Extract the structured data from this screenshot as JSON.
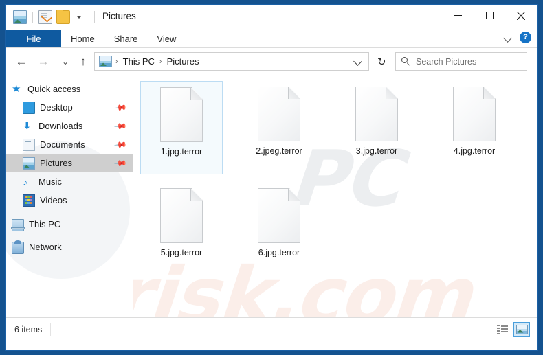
{
  "window": {
    "title": "Pictures",
    "minimize_label": "─",
    "maximize_label": "□",
    "close_label": "✕"
  },
  "quick_access_toolbar": {
    "items": [
      {
        "name": "pictures-properties-icon"
      },
      {
        "name": "properties-icon"
      },
      {
        "name": "new-folder-icon"
      },
      {
        "name": "customize-caret-icon"
      }
    ]
  },
  "ribbon": {
    "tabs": [
      {
        "label": "File",
        "active": true
      },
      {
        "label": "Home",
        "active": false
      },
      {
        "label": "Share",
        "active": false
      },
      {
        "label": "View",
        "active": false
      }
    ],
    "collapse_icon": "chevron-down-icon",
    "help_label": "?"
  },
  "addressbar": {
    "back_glyph": "←",
    "forward_glyph": "→",
    "recent_glyph": "⌄",
    "up_glyph": "↑",
    "breadcrumb": [
      {
        "label": "This PC"
      },
      {
        "label": "Pictures"
      }
    ],
    "separator": "›",
    "refresh_glyph": "↻"
  },
  "search": {
    "placeholder": "Search Pictures",
    "value": ""
  },
  "sidebar": {
    "items": [
      {
        "label": "Quick access",
        "icon": "star-icon",
        "indent": 8,
        "pinned": false,
        "selected": false
      },
      {
        "label": "Desktop",
        "icon": "desktop-icon",
        "indent": 24,
        "pinned": true,
        "selected": false
      },
      {
        "label": "Downloads",
        "icon": "download-icon",
        "indent": 24,
        "pinned": true,
        "selected": false
      },
      {
        "label": "Documents",
        "icon": "documents-icon",
        "indent": 24,
        "pinned": true,
        "selected": false
      },
      {
        "label": "Pictures",
        "icon": "pictures-icon",
        "indent": 24,
        "pinned": true,
        "selected": true
      },
      {
        "label": "Music",
        "icon": "music-icon",
        "indent": 24,
        "pinned": false,
        "selected": false
      },
      {
        "label": "Videos",
        "icon": "videos-icon",
        "indent": 24,
        "pinned": false,
        "selected": false
      },
      {
        "label": "This PC",
        "icon": "this-pc-icon",
        "indent": 8,
        "pinned": false,
        "selected": false
      },
      {
        "label": "Network",
        "icon": "network-icon",
        "indent": 8,
        "pinned": false,
        "selected": false
      }
    ],
    "pin_glyph": "📌"
  },
  "files": [
    {
      "name": "1.jpg.terror",
      "selected": true
    },
    {
      "name": "2.jpeg.terror",
      "selected": false
    },
    {
      "name": "3.jpg.terror",
      "selected": false
    },
    {
      "name": "4.jpg.terror",
      "selected": false
    },
    {
      "name": "5.jpg.terror",
      "selected": false
    },
    {
      "name": "6.jpg.terror",
      "selected": false
    }
  ],
  "watermark": {
    "grey_text": "PC",
    "pink_text": "risk.com"
  },
  "statusbar": {
    "item_count": "6 items",
    "view_details_icon": "details-view-icon",
    "view_large_icons_icon": "large-icons-view-icon"
  },
  "colors": {
    "accent_blue": "#0f5aa0",
    "frame_blue": "#14528f",
    "selection_border": "#bcdcf3",
    "sidebar_selected": "#cfcfcf"
  }
}
